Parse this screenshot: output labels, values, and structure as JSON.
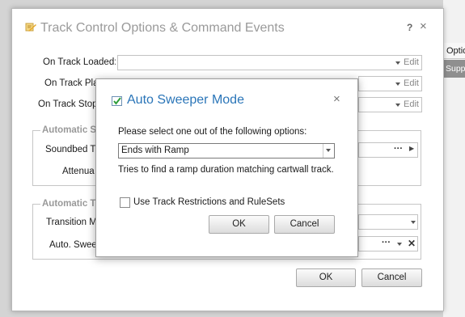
{
  "background": {
    "options_tab": "Optio",
    "supp_cell": "Supp"
  },
  "main_dialog": {
    "title": "Track Control Options & Command Events",
    "help_icon": "?",
    "close_icon": "×",
    "rows": [
      {
        "label": "On Track Loaded:",
        "edit": "Edit"
      },
      {
        "label": "On Track Play",
        "edit": "Edit"
      },
      {
        "label": "On Track Stopp",
        "edit": "Edit"
      }
    ],
    "group1": {
      "title": "Automatic S",
      "soundbed_label": "Soundbed Tr",
      "attenuation_label": "Attenua",
      "more_icon": "···",
      "play_icon": "▶"
    },
    "group2": {
      "title": "Automatic T",
      "transition_label": "Transition Mo",
      "sweeper_label": "Auto. Swee",
      "more_icon": "···",
      "clear_icon": "✕"
    },
    "ok_label": "OK",
    "cancel_label": "Cancel"
  },
  "modal": {
    "title": "Auto Sweeper Mode",
    "close_icon": "×",
    "prompt": "Please select one out of the following options:",
    "select_value": "Ends with Ramp",
    "description": "Tries to find a ramp duration matching cartwall track.",
    "checkbox_label": "Use Track Restrictions and RuleSets",
    "checkbox_checked": false,
    "ok_label": "OK",
    "cancel_label": "Cancel"
  },
  "colors": {
    "modal_title": "#2a75b8",
    "main_title": "#9a9a9a",
    "group_title": "#999999",
    "bg_selected_cell": "#8f8f8f"
  }
}
